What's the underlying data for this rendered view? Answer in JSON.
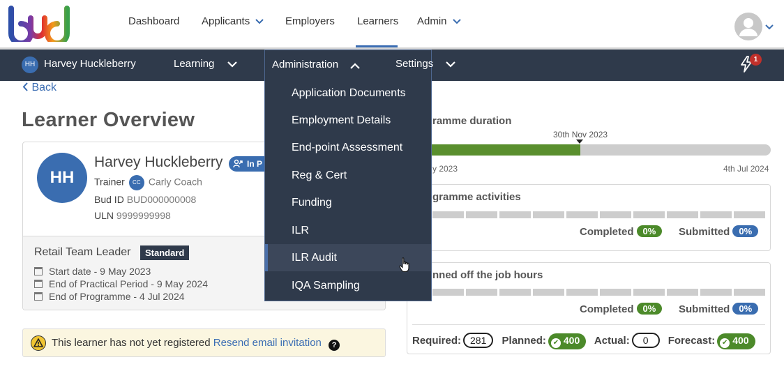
{
  "topnav": {
    "items": [
      {
        "label": "Dashboard"
      },
      {
        "label": "Applicants"
      },
      {
        "label": "Employers"
      },
      {
        "label": "Learners"
      },
      {
        "label": "Admin"
      }
    ]
  },
  "subbar": {
    "user_initials": "HH",
    "user_name": "Harvey Huckleberry",
    "learning_label": "Learning",
    "administration_label": "Administration",
    "settings_label": "Settings",
    "notification_count": "1"
  },
  "admin_menu": {
    "items": [
      {
        "label": "Application Documents"
      },
      {
        "label": "Employment Details"
      },
      {
        "label": "End-point Assessment"
      },
      {
        "label": "Reg & Cert"
      },
      {
        "label": "Funding"
      },
      {
        "label": "ILR"
      },
      {
        "label": "ILR Audit"
      },
      {
        "label": "IQA Sampling"
      }
    ],
    "hovered": "ILR Audit"
  },
  "back_label": "Back",
  "page_title": "Learner Overview",
  "learner": {
    "initials": "HH",
    "name": "Harvey Huckleberry",
    "status": "In P",
    "trainer_label": "Trainer",
    "trainer_initials": "CC",
    "trainer_name": "Carly Coach",
    "bud_id_label": "Bud ID",
    "bud_id": "BUD000000008",
    "uln_label": "ULN",
    "uln": "9999999998"
  },
  "programme": {
    "name": "Retail Team Leader",
    "badge": "Standard",
    "start_date": "Start date - 9 May 2023",
    "end_practical": "End of Practical Period - 9 May 2024",
    "end_programme": "End of Programme - 4 Jul 2024"
  },
  "warning": {
    "text": "This learner has not yet registered",
    "link": "Resend email invitation",
    "help": "?"
  },
  "duration": {
    "title": "ramme duration",
    "today_label": "30th Nov 2023",
    "start_label": "y 2023",
    "end_label": "4th Jul 2024",
    "progress_pct": 44
  },
  "activities": {
    "title": "gramme activities",
    "completed_label": "Completed",
    "completed_value": "0%",
    "submitted_label": "Submitted",
    "submitted_value": "0%"
  },
  "hours": {
    "title": "nned off the job hours",
    "completed_label": "Completed",
    "completed_value": "0%",
    "submitted_label": "Submitted",
    "submitted_value": "0%",
    "required_label": "Required:",
    "required_value": "281",
    "planned_label": "Planned:",
    "planned_value": "400",
    "actual_label": "Actual:",
    "actual_value": "0",
    "forecast_label": "Forecast:",
    "forecast_value": "400"
  },
  "colors": {
    "navy": "#2f3a4b",
    "accent_blue": "#3a6db0",
    "green": "#4c8a2a"
  }
}
